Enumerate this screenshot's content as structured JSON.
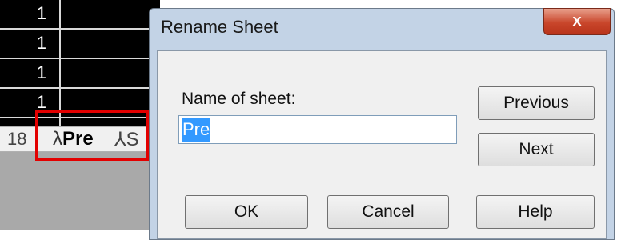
{
  "spreadsheet": {
    "cells": [
      "1",
      "1",
      "1",
      "1"
    ],
    "tabs": {
      "partial_number": "18",
      "current": "Pre",
      "next_partial": "S"
    }
  },
  "dialog": {
    "title": "Rename Sheet",
    "close_symbol": "x",
    "name_label": "Name of sheet:",
    "name_value": "Pre",
    "buttons": {
      "previous": "Previous",
      "next": "Next",
      "ok": "OK",
      "cancel": "Cancel",
      "help": "Help"
    }
  },
  "colors": {
    "highlight": "#e30000",
    "selection": "#3399ff",
    "title_bar": "#c3d3e6",
    "close_button": "#c9462b"
  }
}
